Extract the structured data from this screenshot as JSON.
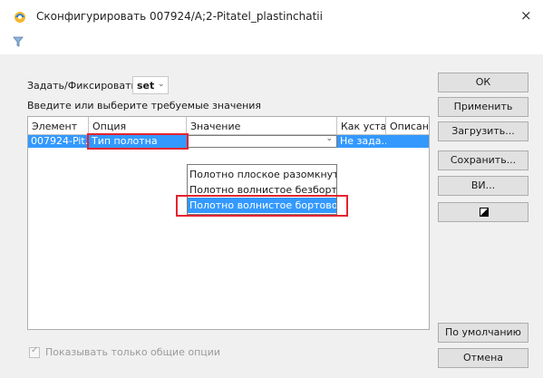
{
  "window": {
    "title": "Сконфигурировать 007924/A;2-Pitatel_plastinchatii",
    "close_glyph": "×"
  },
  "form": {
    "set_label": "Задать/Фиксировать:",
    "set_value": "set",
    "instructions": "Введите или выберите требуемые значения"
  },
  "grid": {
    "columns": [
      "Элемент",
      "Опция",
      "Значение",
      "Как устан",
      "Описани"
    ],
    "row": {
      "element": "007924-Pit...",
      "option": "Тип полотна",
      "value": "",
      "how_set": "Не зада...",
      "description": ""
    },
    "dropdown_options": [
      "Полотно плоское разомкнуто",
      "Полотно волнистое безбортов",
      "Полотно волнистое бортовое"
    ],
    "highlighted_option_index": 2
  },
  "buttons": {
    "ok": "ОК",
    "apply": "Применить",
    "load": "Загрузить...",
    "save": "Сохранить...",
    "vi": "ВИ...",
    "defaults": "По умолчанию",
    "cancel": "Отмена"
  },
  "footer": {
    "common_options_label": "Показывать только общие опции",
    "common_options_checked": true
  },
  "colors": {
    "selection": "#3399ff",
    "highlight_box": "#e52330",
    "panel_bg": "#f0f0f0"
  }
}
